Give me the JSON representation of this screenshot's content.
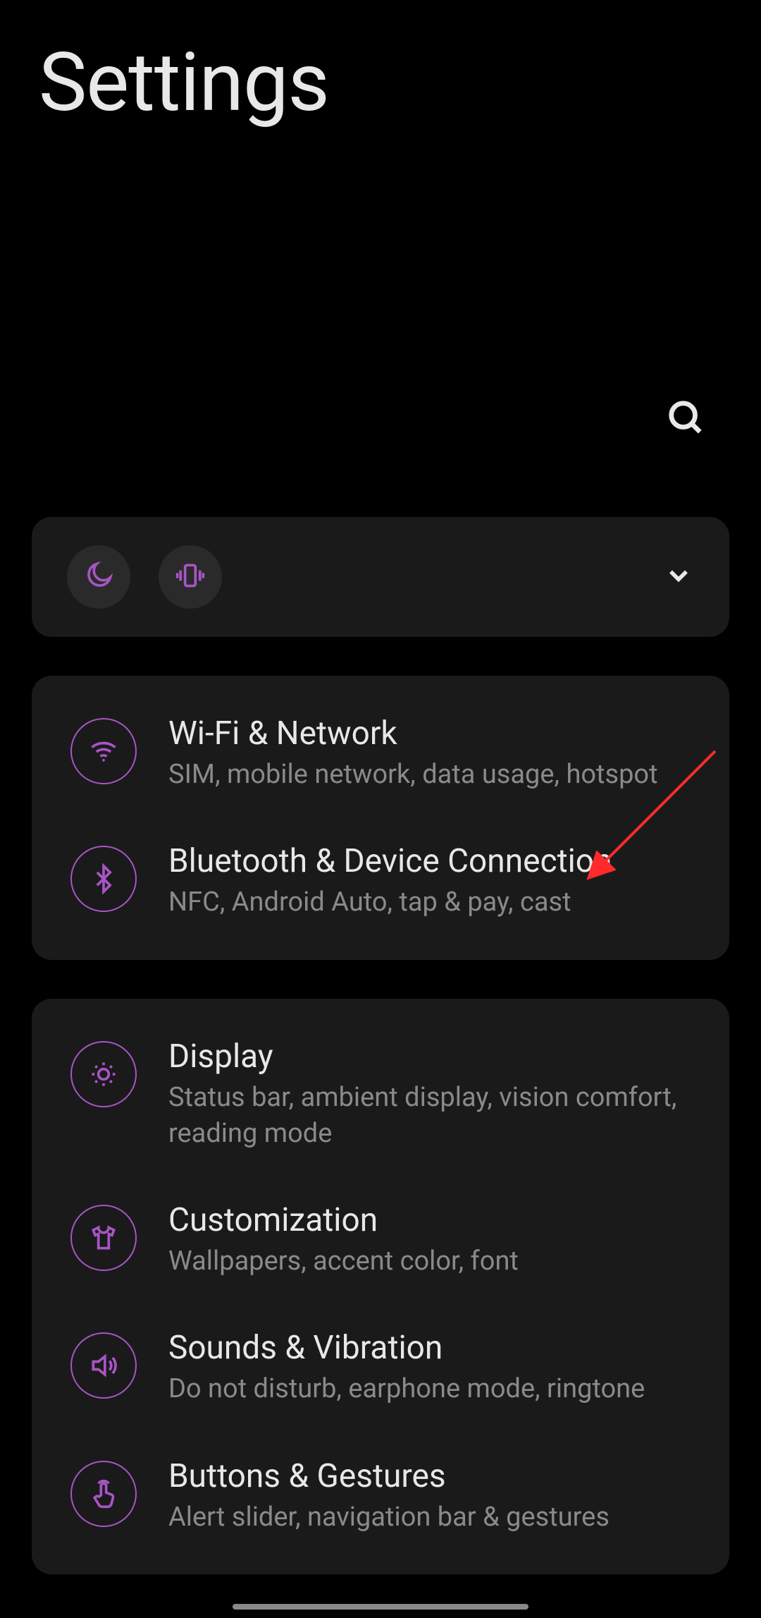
{
  "page_title": "Settings",
  "accent_color": "#a855c7",
  "groups": [
    {
      "items": [
        {
          "title": "Wi-Fi & Network",
          "sub": "SIM, mobile network, data usage, hotspot"
        },
        {
          "title": "Bluetooth & Device Connection",
          "sub": "NFC, Android Auto, tap & pay, cast"
        }
      ]
    },
    {
      "items": [
        {
          "title": "Display",
          "sub": "Status bar, ambient display, vision comfort, reading mode"
        },
        {
          "title": "Customization",
          "sub": "Wallpapers, accent color, font"
        },
        {
          "title": "Sounds & Vibration",
          "sub": "Do not disturb, earphone mode, ringtone"
        },
        {
          "title": "Buttons & Gestures",
          "sub": "Alert slider, navigation bar & gestures"
        }
      ]
    }
  ]
}
